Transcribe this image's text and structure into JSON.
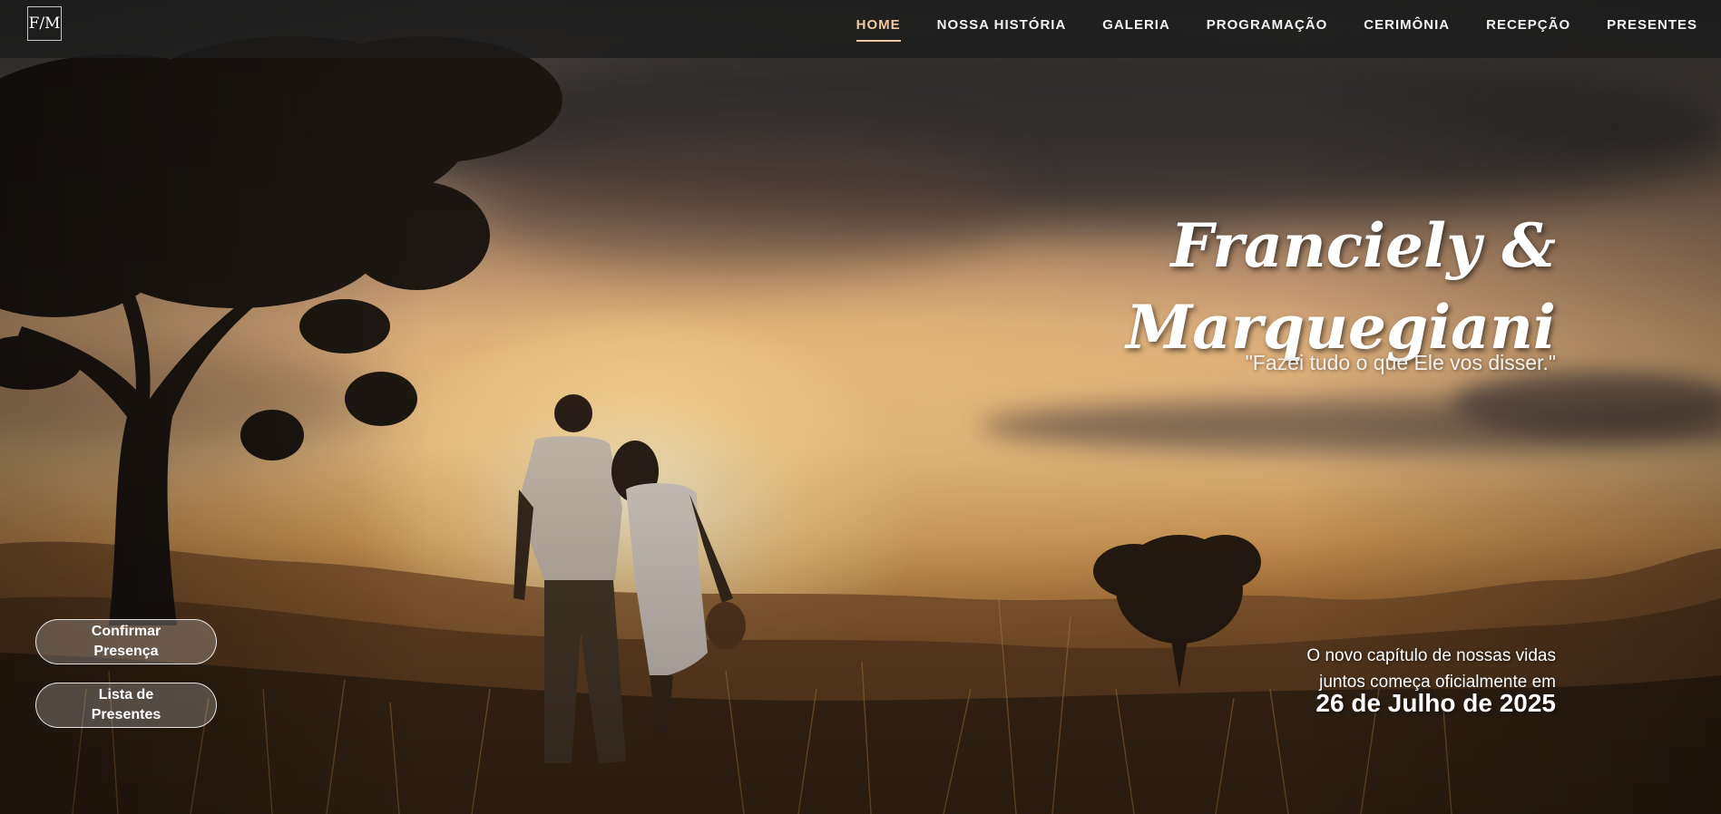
{
  "logo": {
    "text": "F/M"
  },
  "nav": {
    "items": [
      {
        "label": "HOME",
        "active": true
      },
      {
        "label": "NOSSA HISTÓRIA",
        "active": false
      },
      {
        "label": "GALERIA",
        "active": false
      },
      {
        "label": "PROGRAMAÇÃO",
        "active": false
      },
      {
        "label": "CERIMÔNIA",
        "active": false
      },
      {
        "label": "RECEPÇÃO",
        "active": false
      },
      {
        "label": "PRESENTES",
        "active": false
      }
    ]
  },
  "hero": {
    "names_line1": "Franciely &",
    "names_line2": "Marquegiani",
    "quote": "\"Fazei tudo o que Ele vos disser.\"",
    "subtitle_line1": "O novo capítulo de nossas vidas",
    "subtitle_line2": "juntos começa oficialmente em",
    "date": "26 de Julho de 2025"
  },
  "buttons": {
    "rsvp": "Confirmar Presença",
    "gifts": "Lista de Presentes"
  },
  "colors": {
    "nav_active": "#f3c9a4",
    "navbar_bg": "#1c1c1c"
  }
}
